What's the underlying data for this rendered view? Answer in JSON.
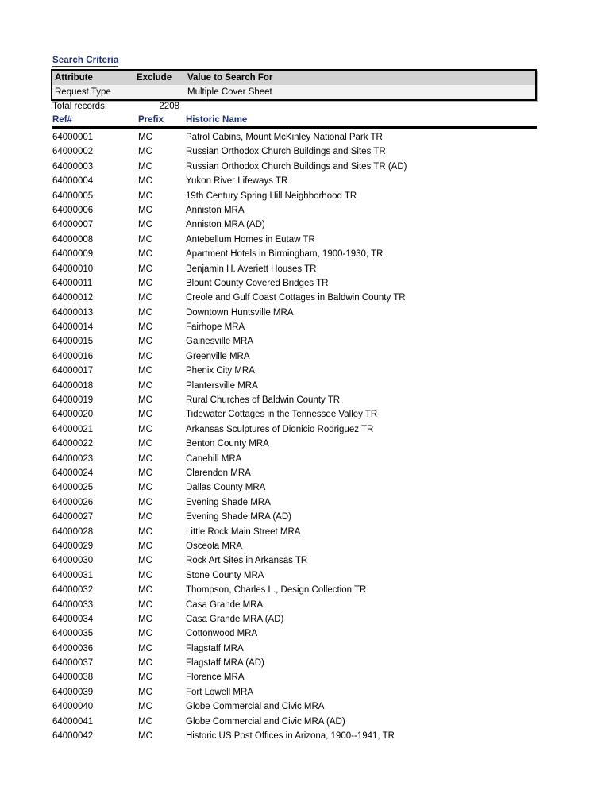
{
  "document": {
    "criteria_title": "Search Criteria"
  },
  "criteria": {
    "headers": {
      "attribute": "Attribute",
      "exclude": "Exclude",
      "value": "Value to Search For"
    },
    "rows": [
      {
        "attribute": "Request Type",
        "exclude": "",
        "value": "Multiple Cover Sheet"
      }
    ]
  },
  "totals": {
    "label": "Total records:",
    "value": "2208"
  },
  "results": {
    "headers": {
      "ref": "Ref#",
      "prefix": "Prefix",
      "name": "Historic Name"
    },
    "rows": [
      {
        "ref": "64000001",
        "prefix": "MC",
        "name": "Patrol Cabins, Mount McKinley National Park TR"
      },
      {
        "ref": "64000002",
        "prefix": "MC",
        "name": "Russian Orthodox Church Buildings and Sites TR"
      },
      {
        "ref": "64000003",
        "prefix": "MC",
        "name": "Russian Orthodox Church Buildings and Sites TR (AD)"
      },
      {
        "ref": "64000004",
        "prefix": "MC",
        "name": "Yukon River Lifeways TR"
      },
      {
        "ref": "64000005",
        "prefix": "MC",
        "name": "19th Century Spring Hill Neighborhood TR"
      },
      {
        "ref": "64000006",
        "prefix": "MC",
        "name": "Anniston MRA"
      },
      {
        "ref": "64000007",
        "prefix": "MC",
        "name": "Anniston MRA (AD)"
      },
      {
        "ref": "64000008",
        "prefix": "MC",
        "name": "Antebellum Homes in Eutaw TR"
      },
      {
        "ref": "64000009",
        "prefix": "MC",
        "name": "Apartment Hotels in Birmingham, 1900-1930, TR"
      },
      {
        "ref": "64000010",
        "prefix": "MC",
        "name": "Benjamin H. Averiett Houses TR"
      },
      {
        "ref": "64000011",
        "prefix": "MC",
        "name": "Blount County Covered Bridges TR"
      },
      {
        "ref": "64000012",
        "prefix": "MC",
        "name": "Creole and Gulf Coast Cottages in Baldwin County TR"
      },
      {
        "ref": "64000013",
        "prefix": "MC",
        "name": "Downtown Huntsville MRA"
      },
      {
        "ref": "64000014",
        "prefix": "MC",
        "name": "Fairhope MRA"
      },
      {
        "ref": "64000015",
        "prefix": "MC",
        "name": "Gainesville MRA"
      },
      {
        "ref": "64000016",
        "prefix": "MC",
        "name": "Greenville MRA"
      },
      {
        "ref": "64000017",
        "prefix": "MC",
        "name": "Phenix City MRA"
      },
      {
        "ref": "64000018",
        "prefix": "MC",
        "name": "Plantersville MRA"
      },
      {
        "ref": "64000019",
        "prefix": "MC",
        "name": "Rural Churches of Baldwin County TR"
      },
      {
        "ref": "64000020",
        "prefix": "MC",
        "name": "Tidewater Cottages in the Tennessee Valley TR"
      },
      {
        "ref": "64000021",
        "prefix": "MC",
        "name": "Arkansas Sculptures of Dionicio Rodriguez TR"
      },
      {
        "ref": "64000022",
        "prefix": "MC",
        "name": "Benton County MRA"
      },
      {
        "ref": "64000023",
        "prefix": "MC",
        "name": "Canehill MRA"
      },
      {
        "ref": "64000024",
        "prefix": "MC",
        "name": "Clarendon MRA"
      },
      {
        "ref": "64000025",
        "prefix": "MC",
        "name": "Dallas County MRA"
      },
      {
        "ref": "64000026",
        "prefix": "MC",
        "name": "Evening Shade MRA"
      },
      {
        "ref": "64000027",
        "prefix": "MC",
        "name": "Evening Shade MRA (AD)"
      },
      {
        "ref": "64000028",
        "prefix": "MC",
        "name": "Little Rock Main Street MRA"
      },
      {
        "ref": "64000029",
        "prefix": "MC",
        "name": "Osceola MRA"
      },
      {
        "ref": "64000030",
        "prefix": "MC",
        "name": "Rock Art Sites in Arkansas TR"
      },
      {
        "ref": "64000031",
        "prefix": "MC",
        "name": "Stone County MRA"
      },
      {
        "ref": "64000032",
        "prefix": "MC",
        "name": "Thompson, Charles L., Design Collection TR"
      },
      {
        "ref": "64000033",
        "prefix": "MC",
        "name": "Casa Grande MRA"
      },
      {
        "ref": "64000034",
        "prefix": "MC",
        "name": "Casa Grande MRA (AD)"
      },
      {
        "ref": "64000035",
        "prefix": "MC",
        "name": "Cottonwood MRA"
      },
      {
        "ref": "64000036",
        "prefix": "MC",
        "name": "Flagstaff MRA"
      },
      {
        "ref": "64000037",
        "prefix": "MC",
        "name": "Flagstaff MRA (AD)"
      },
      {
        "ref": "64000038",
        "prefix": "MC",
        "name": "Florence MRA"
      },
      {
        "ref": "64000039",
        "prefix": "MC",
        "name": "Fort Lowell MRA"
      },
      {
        "ref": "64000040",
        "prefix": "MC",
        "name": "Globe Commercial and Civic MRA"
      },
      {
        "ref": "64000041",
        "prefix": "MC",
        "name": "Globe Commercial and Civic MRA (AD)"
      },
      {
        "ref": "64000042",
        "prefix": "MC",
        "name": "Historic US Post Offices in Arizona, 1900--1941, TR"
      }
    ]
  },
  "colors": {
    "heading": "#1F3070",
    "criteria_header_bg": "#d2d2d2",
    "criteria_row_bg": "#f2f2f2",
    "rule": "#000000"
  }
}
